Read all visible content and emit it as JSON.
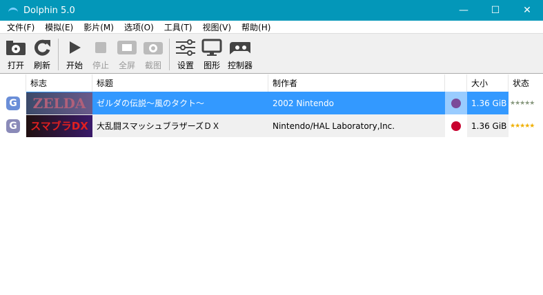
{
  "window": {
    "title": "Dolphin 5.0",
    "minimize": "—",
    "maximize": "☐",
    "close": "✕"
  },
  "menu": [
    "文件(F)",
    "模拟(E)",
    "影片(M)",
    "选项(O)",
    "工具(T)",
    "视图(V)",
    "帮助(H)"
  ],
  "toolbar": {
    "open": "打开",
    "refresh": "刷新",
    "play": "开始",
    "stop": "停止",
    "fullscreen": "全屏",
    "screenshot": "截图",
    "config": "设置",
    "graphics": "图形",
    "controllers": "控制器"
  },
  "columns": {
    "banner": "标志",
    "title": "标题",
    "maker": "制作者",
    "size": "大小",
    "state": "状态"
  },
  "games": [
    {
      "platform": "gamecube",
      "banner": "ZELDA",
      "title": "ゼルダの伝説～風のタクト～",
      "maker": "2002 Nintendo",
      "region_color": "#7b4b9a",
      "size": "1.36 GiB",
      "stars": "★★★★★",
      "selected": true
    },
    {
      "platform": "gamecube",
      "banner": "スマブラDX",
      "title": "大乱闘スマッシュブラザーズＤＸ",
      "maker": "Nintendo/HAL Laboratory,Inc.",
      "region_color": "#c8002e",
      "size": "1.36 GiB",
      "stars": "★★★★★",
      "selected": false
    }
  ]
}
